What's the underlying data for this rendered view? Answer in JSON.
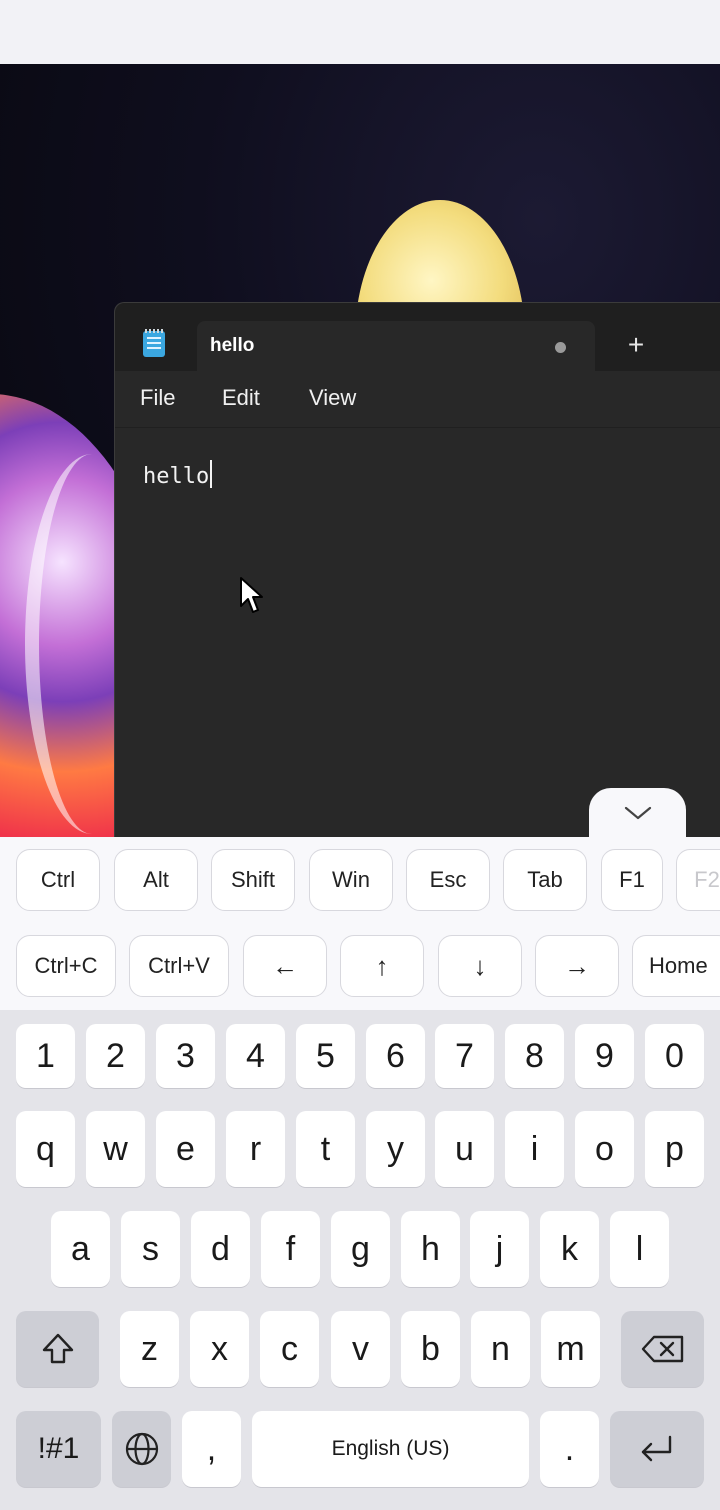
{
  "notepad": {
    "tab_title": "hello",
    "new_tab_label": "+",
    "menu": [
      "File",
      "Edit",
      "View"
    ],
    "content": "hello"
  },
  "extra_keys": {
    "row1": [
      "Ctrl",
      "Alt",
      "Shift",
      "Win",
      "Esc",
      "Tab",
      "F1",
      "F2"
    ],
    "row2": [
      "Ctrl+C",
      "Ctrl+V",
      "←",
      "↑",
      "↓",
      "→",
      "Home"
    ]
  },
  "keyboard": {
    "numbers": [
      "1",
      "2",
      "3",
      "4",
      "5",
      "6",
      "7",
      "8",
      "9",
      "0"
    ],
    "row1": [
      "q",
      "w",
      "e",
      "r",
      "t",
      "y",
      "u",
      "i",
      "o",
      "p"
    ],
    "row2": [
      "a",
      "s",
      "d",
      "f",
      "g",
      "h",
      "j",
      "k",
      "l"
    ],
    "row3": [
      "z",
      "x",
      "c",
      "v",
      "b",
      "n",
      "m"
    ],
    "symbols_label": "!#1",
    "comma": ",",
    "space_label": "English (US)",
    "period": "."
  },
  "icons": {
    "shift": "shift-arrow-icon",
    "backspace": "backspace-icon",
    "globe": "globe-icon",
    "enter": "enter-icon",
    "collapse": "chevron-down-icon",
    "notepad": "notepad-icon",
    "pointer": "mouse-pointer-icon"
  }
}
